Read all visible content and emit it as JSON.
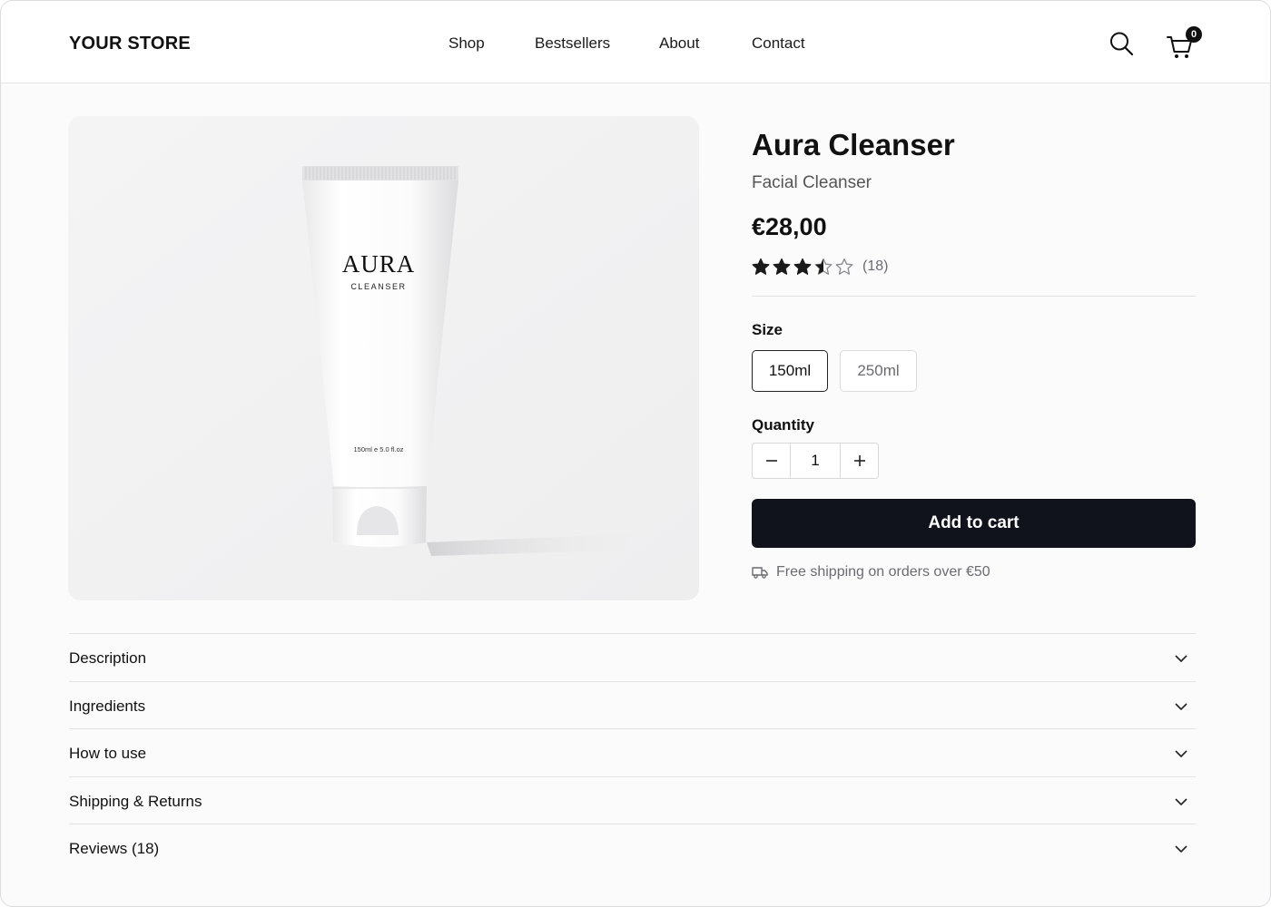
{
  "header": {
    "logo": "YOUR STORE",
    "nav": [
      {
        "label": "Shop"
      },
      {
        "label": "Bestsellers"
      },
      {
        "label": "About"
      },
      {
        "label": "Contact"
      }
    ],
    "cart_count": "0",
    "icons": [
      "search-icon",
      "cart-icon"
    ]
  },
  "image": {
    "brand": "AURA",
    "product_line": "CLEANSER",
    "volume": "150ml e 5.0 fl.oz"
  },
  "product": {
    "title": "Aura Cleanser",
    "subtitle": "Facial Cleanser",
    "price": "€28,00",
    "rating": 3.5,
    "rating_max": 5,
    "review_count": "(18)",
    "size_label": "Size",
    "sizes": [
      {
        "label": "150ml",
        "selected": true
      },
      {
        "label": "250ml",
        "selected": false
      }
    ],
    "quantity_label": "Quantity",
    "quantity": "1",
    "add_to_cart": "Add to cart",
    "shipping_note": "Free shipping on orders over €50"
  },
  "accordion": [
    {
      "label": "Description"
    },
    {
      "label": "Ingredients"
    },
    {
      "label": "How to use"
    },
    {
      "label": "Shipping & Returns"
    },
    {
      "label": "Reviews (18)"
    }
  ],
  "colors": {
    "primary_button": "#11131c",
    "star": "#1a1a1a"
  }
}
